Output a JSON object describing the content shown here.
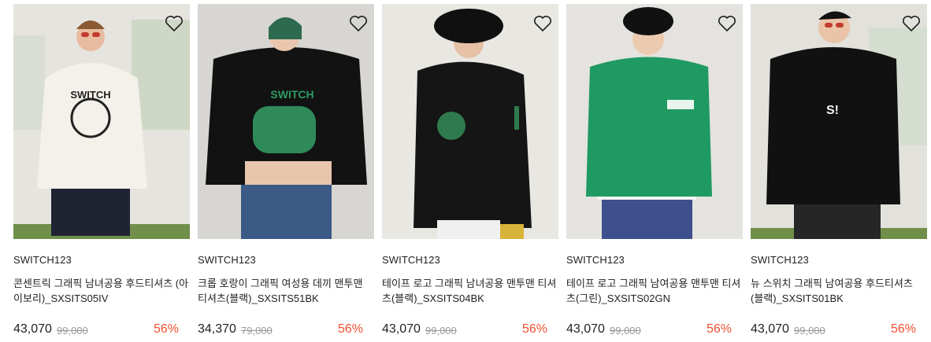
{
  "products": [
    {
      "brand": "SWITCH123",
      "name": "콘센트릭 그래픽 남녀공용 후드티셔츠 (아이보리)_SXSITS05IV",
      "price": "43,070",
      "original_price": "99,000",
      "discount": "56%",
      "image": "model-ivory-hoodie",
      "wishlist_icon": "heart-outline-icon"
    },
    {
      "brand": "SWITCH123",
      "name": "크롭 호랑이 그래픽 여성용 데끼 맨투맨 티셔츠(블랙)_SXSITS51BK",
      "price": "34,370",
      "original_price": "79,000",
      "discount": "56%",
      "image": "model-black-crop-sweatshirt",
      "wishlist_icon": "heart-outline-icon"
    },
    {
      "brand": "SWITCH123",
      "name": "테이프 로고 그래픽 남녀공용 맨투맨 티셔츠(블랙)_SXSITS04BK",
      "price": "43,070",
      "original_price": "99,000",
      "discount": "56%",
      "image": "model-black-sweatshirt",
      "wishlist_icon": "heart-outline-icon"
    },
    {
      "brand": "SWITCH123",
      "name": "테이프 로고 그래픽 남여공용 맨투맨 티셔츠(그린)_SXSITS02GN",
      "price": "43,070",
      "original_price": "99,000",
      "discount": "56%",
      "image": "model-green-sweatshirt",
      "wishlist_icon": "heart-outline-icon"
    },
    {
      "brand": "SWITCH123",
      "name": "뉴 스위치 그래픽 남여공용 후드티셔츠 (블랙)_SXSITS01BK",
      "price": "43,070",
      "original_price": "99,000",
      "discount": "56%",
      "image": "model-black-hoodie",
      "wishlist_icon": "heart-outline-icon"
    }
  ],
  "colors": {
    "discount": "#f0502f",
    "original_price": "#999999",
    "text": "#222222"
  }
}
